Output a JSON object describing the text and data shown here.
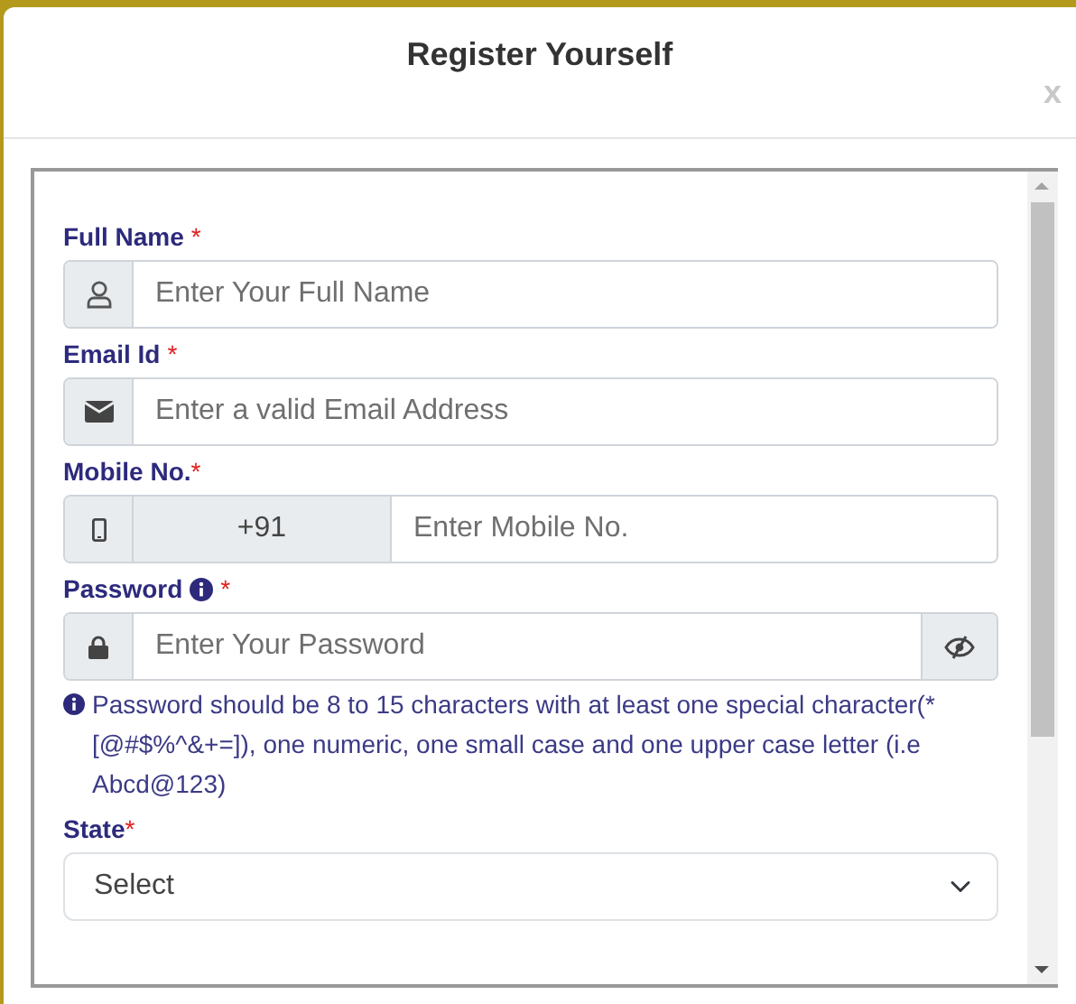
{
  "modal": {
    "title": "Register Yourself",
    "close": "x"
  },
  "fields": [
    {
      "kind": "name",
      "label": "Full Name",
      "required_mark": "*",
      "placeholder": "Enter Your Full Name"
    },
    {
      "kind": "email",
      "label": "Email Id",
      "required_mark": "*",
      "placeholder": "Enter a valid Email Address"
    },
    {
      "kind": "phone",
      "label": "Mobile No.",
      "required_mark": "*",
      "prefix": "+91",
      "placeholder": "Enter Mobile No."
    },
    {
      "kind": "password",
      "label": "Password",
      "required_mark": "*",
      "info": true,
      "placeholder": "Enter Your Password",
      "hint": "Password should be 8 to 15 characters with at least one special character(*[@#$%^&+=]), one numeric, one small case and one upper case letter (i.e Abcd@123)"
    },
    {
      "kind": "select",
      "label": "State",
      "required_mark": "*",
      "value": "Select"
    }
  ]
}
